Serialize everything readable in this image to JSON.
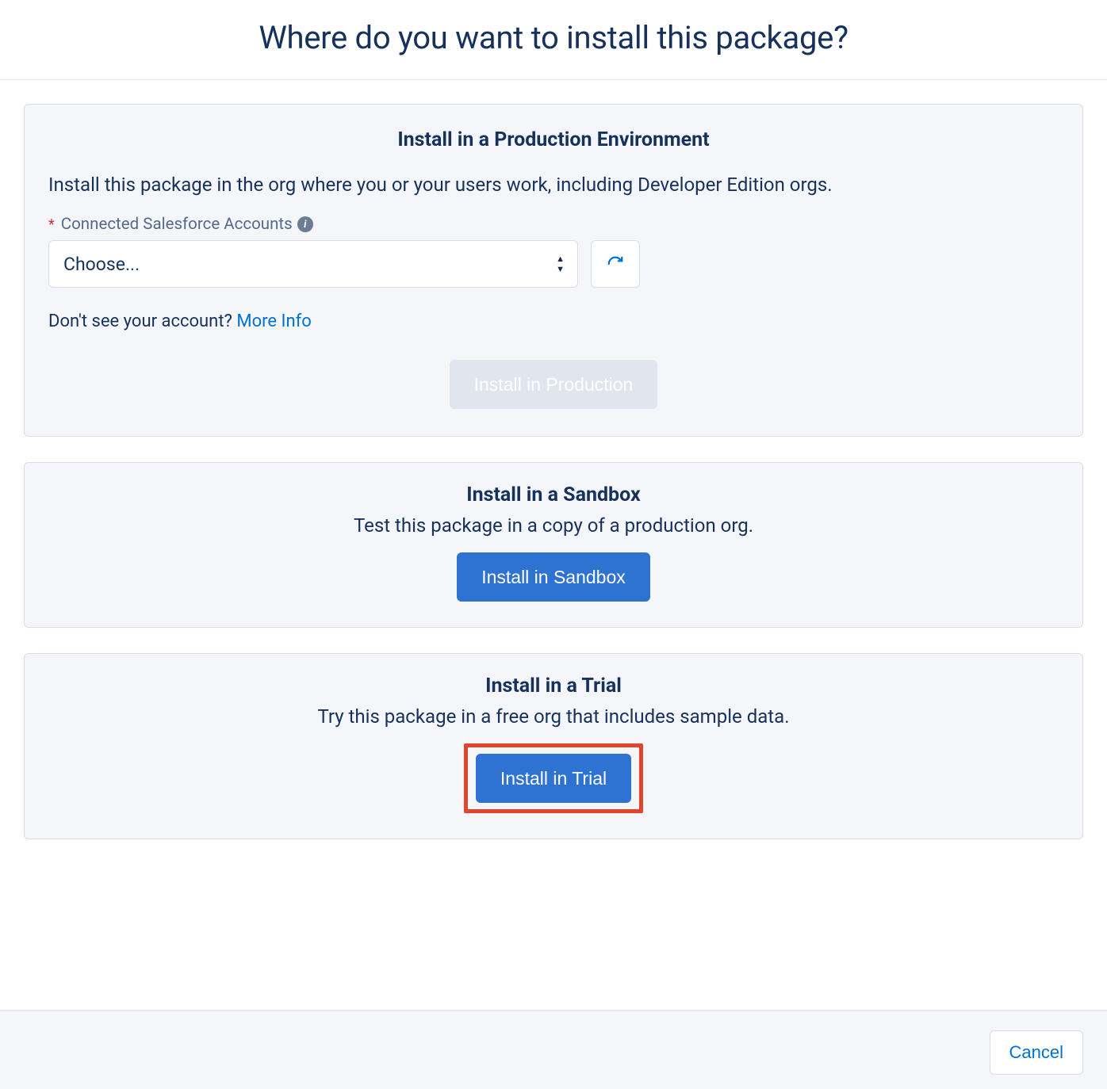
{
  "header": {
    "title": "Where do you want to install this package?"
  },
  "production": {
    "title": "Install in a Production Environment",
    "description": "Install this package in the org where you or your users work, including Developer Edition orgs.",
    "field_label": "Connected Salesforce Accounts",
    "select_placeholder": "Choose...",
    "helper_prefix": "Don't see your account? ",
    "helper_link": "More Info",
    "install_button": "Install in Production"
  },
  "sandbox": {
    "title": "Install in a Sandbox",
    "description": "Test this package in a copy of a production org.",
    "install_button": "Install in Sandbox"
  },
  "trial": {
    "title": "Install in a Trial",
    "description": "Try this package in a free org that includes sample data.",
    "install_button": "Install in Trial"
  },
  "footer": {
    "cancel": "Cancel"
  }
}
